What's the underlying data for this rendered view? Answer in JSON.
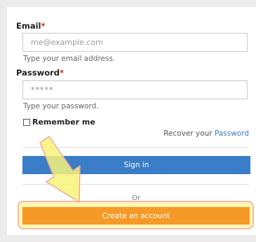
{
  "form": {
    "email": {
      "label": "Email",
      "required_mark": "*",
      "placeholder": "me@example.com",
      "hint": "Type your email address."
    },
    "password": {
      "label": "Password",
      "required_mark": "*",
      "value": "*****",
      "hint": "Type your password."
    },
    "remember_label": "Remember me",
    "recover_prefix": "Recover your",
    "recover_link": "Password",
    "signin_label": "Sign in",
    "or_label": "Or",
    "create_label": "Create an account"
  },
  "colors": {
    "signin_button": "#3b7ec7",
    "create_button": "#f59a28",
    "required": "#d6281f",
    "link": "#3a7cc5",
    "annotation_arrow": "#f7f27a"
  },
  "annotation": {
    "arrow_icon": "pointer-arrow-icon",
    "highlight": "create-account-highlight"
  }
}
